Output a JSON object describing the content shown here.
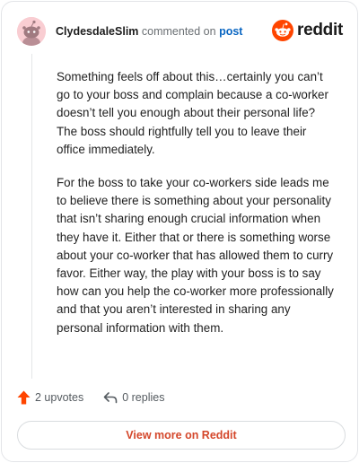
{
  "header": {
    "username": "ClydesdaleSlim",
    "commented_text": "commented on",
    "post_link": "post",
    "brand_name": "reddit",
    "brand_color": "#ff4500"
  },
  "comment": {
    "paragraphs": [
      "Something feels off about this…certainly you can’t go to your boss and complain because a co-worker doesn’t tell you enough about their personal life? The boss should rightfully tell you to leave their office immediately.",
      "For the boss to take your co-workers side leads me to believe there is something about your personality that isn’t sharing enough crucial information when they have it. Either that or there is something worse about your co-worker that has allowed them to curry favor. Either way, the play with your boss is to say how can you help the co-worker more professionally and that you aren’t interested in sharing any personal information with them."
    ]
  },
  "actions": {
    "upvotes_label": "2 upvotes",
    "upvote_icon": "upvote-arrow-icon",
    "upvote_color": "#ff4500",
    "replies_label": "0 replies",
    "reply_icon": "reply-arrow-icon"
  },
  "footer": {
    "view_more_label": "View more on Reddit",
    "view_more_color": "#d4472b"
  }
}
